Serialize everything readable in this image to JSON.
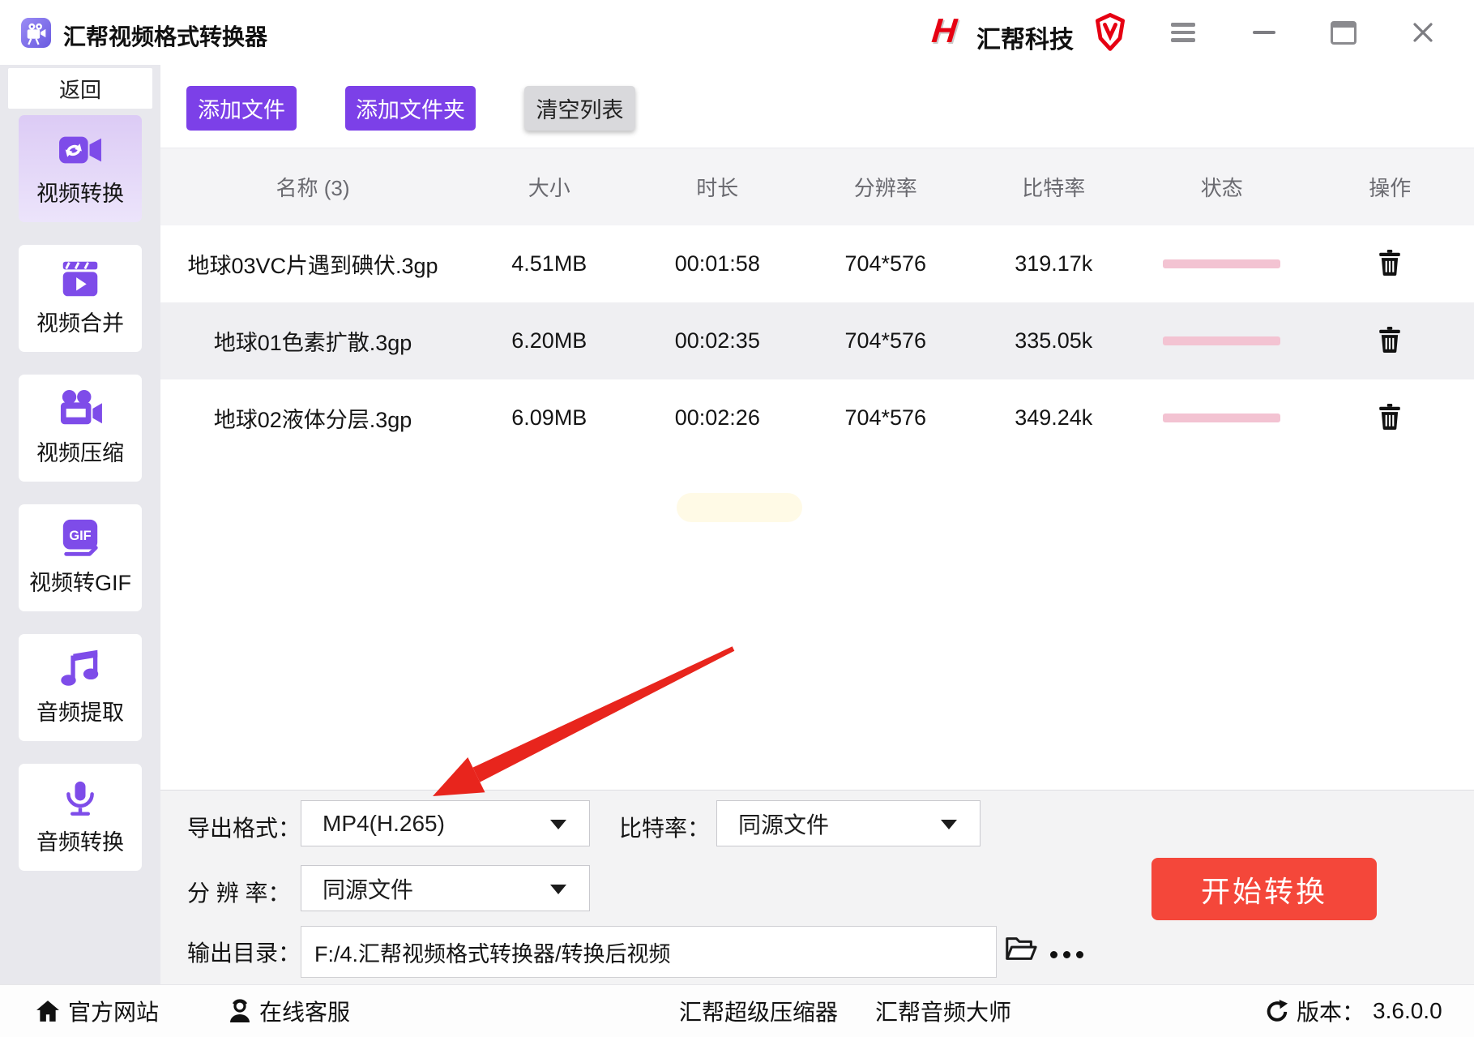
{
  "window": {
    "title": "汇帮视频格式转换器",
    "brand": "汇帮科技",
    "brand_logo_letter": "H",
    "controls": [
      "menu-icon",
      "minimize-icon",
      "maximize-icon",
      "close-icon"
    ]
  },
  "sidebar": {
    "back_label": "返回",
    "gif_icon_text": "GIF",
    "items": [
      {
        "label": "视频转换",
        "icon": "video-convert-icon",
        "active": true
      },
      {
        "label": "视频合并",
        "icon": "video-merge-icon",
        "active": false
      },
      {
        "label": "视频压缩",
        "icon": "video-compress-icon",
        "active": false
      },
      {
        "label": "视频转GIF",
        "icon": "video-to-gif-icon",
        "active": false
      },
      {
        "label": "音频提取",
        "icon": "audio-extract-icon",
        "active": false
      },
      {
        "label": "音频转换",
        "icon": "audio-convert-icon",
        "active": false
      }
    ]
  },
  "toolbar": {
    "add_file": "添加文件",
    "add_folder": "添加文件夹",
    "clear_list": "清空列表"
  },
  "table": {
    "headers": [
      "名称 (3)",
      "大小",
      "时长",
      "分辨率",
      "比特率",
      "状态",
      "操作"
    ],
    "rows": [
      {
        "name": "地球03VC片遇到碘伏.3gp",
        "size": "4.51MB",
        "duration": "00:01:58",
        "resolution": "704*576",
        "bitrate": "319.17k"
      },
      {
        "name": "地球01色素扩散.3gp",
        "size": "6.20MB",
        "duration": "00:02:35",
        "resolution": "704*576",
        "bitrate": "335.05k"
      },
      {
        "name": "地球02液体分层.3gp",
        "size": "6.09MB",
        "duration": "00:02:26",
        "resolution": "704*576",
        "bitrate": "349.24k"
      }
    ]
  },
  "settings": {
    "export_format": {
      "label": "导出格式：",
      "value": "MP4(H.265)"
    },
    "bitrate": {
      "label": "比特率：",
      "value": "同源文件"
    },
    "resolution": {
      "label": "分 辨 率：",
      "value": "同源文件"
    },
    "output_dir": {
      "label": "输出目录：",
      "value": "F:/4.汇帮视频格式转换器/转换后视频"
    },
    "start_button": "开始转换"
  },
  "statusbar": {
    "official_site": "官方网站",
    "online_support": "在线客服",
    "super_compressor": "汇帮超级压缩器",
    "audio_master": "汇帮音频大师",
    "version_label": "版本：",
    "version": "3.6.0.0"
  },
  "colors": {
    "accent_purple": "#7C40E8",
    "icon_purple": "#7E4CE9",
    "active_item_bg": "#DCCBF5",
    "start_red": "#F4473A",
    "brand_red": "#E60012",
    "arrow_red": "#E8251D",
    "progress_pink": "#F3C3D2",
    "sidebar_bg": "#E8E8ED",
    "panel_bg": "#F3F3F4"
  }
}
